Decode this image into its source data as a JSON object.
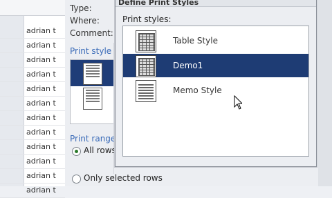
{
  "list": {
    "rows": [
      "adrian t",
      "adrian t",
      "adrian t",
      "adrian t",
      "adrian t",
      "adrian t",
      "adrian t",
      "adrian t",
      "adrian t",
      "adrian t",
      "adrian t",
      "adrian t"
    ]
  },
  "print_dialog": {
    "type_label": "Type:",
    "where_label": "Where:",
    "comment_label": "Comment:",
    "print_style_section": "Print style",
    "print_range_section": "Print range",
    "all_rows": "All rows",
    "only_selected": "Only selected rows"
  },
  "define_dialog": {
    "title": "Define Print Styles",
    "caption": "Print styles:",
    "styles": [
      {
        "label": "Table Style",
        "icon": "table-style-icon",
        "selected": false
      },
      {
        "label": "Demo1",
        "icon": "table-style-icon",
        "selected": true
      },
      {
        "label": "Memo Style",
        "icon": "memo-style-icon",
        "selected": false
      }
    ]
  },
  "colors": {
    "selection": "#1e3c74",
    "section_blue": "#3a6bb8"
  }
}
